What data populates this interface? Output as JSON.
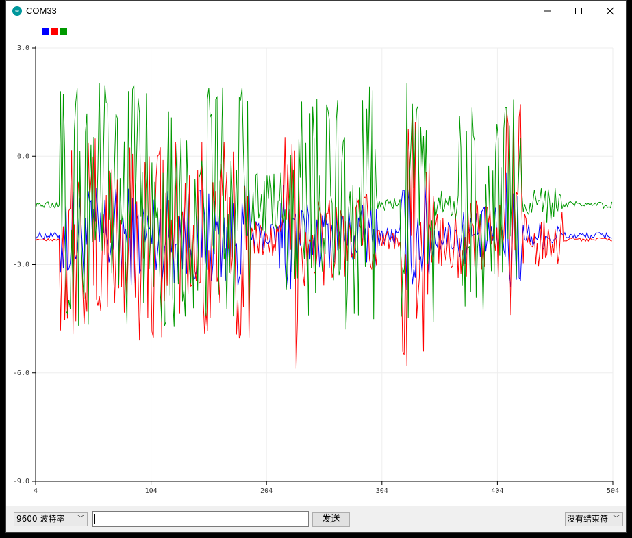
{
  "window": {
    "title": "COM33",
    "app_icon": "arduino-logo-icon"
  },
  "legend": {
    "colors": [
      "#0000ff",
      "#ff0000",
      "#009900"
    ]
  },
  "chart_data": {
    "type": "line",
    "xlim": [
      4,
      504
    ],
    "ylim": [
      -9.0,
      3.0
    ],
    "x_ticks": [
      "4",
      "104",
      "204",
      "304",
      "404",
      "504"
    ],
    "y_ticks": [
      "3.0",
      "0.0",
      "-3.0",
      "-6.0",
      "-9.0"
    ],
    "grid": true,
    "legend_placement": "top-left",
    "series": [
      {
        "color": "#0000ff",
        "baseline": -2.2,
        "segments": [
          {
            "x": [
              4,
              25
            ],
            "amp": 0.1
          },
          {
            "x": [
              25,
              190
            ],
            "amp": 1.4
          },
          {
            "x": [
              190,
              215
            ],
            "amp": 0.4
          },
          {
            "x": [
              215,
              232
            ],
            "amp": 2.0
          },
          {
            "x": [
              232,
              300
            ],
            "amp": 0.9
          },
          {
            "x": [
              300,
              320
            ],
            "amp": 0.3
          },
          {
            "x": [
              320,
              349
            ],
            "amp": 1.6
          },
          {
            "x": [
              349,
              370
            ],
            "amp": 0.5
          },
          {
            "x": [
              370,
              410
            ],
            "amp": 0.8
          },
          {
            "x": [
              410,
              424
            ],
            "amp": 1.8
          },
          {
            "x": [
              424,
              460
            ],
            "amp": 0.4
          },
          {
            "x": [
              460,
              504
            ],
            "amp": 0.1
          }
        ]
      },
      {
        "color": "#ff0000",
        "baseline": -2.3,
        "segments": [
          {
            "x": [
              4,
              25
            ],
            "amp": 0.05
          },
          {
            "x": [
              25,
              190
            ],
            "amp": 2.8
          },
          {
            "x": [
              190,
              218
            ],
            "amp": 0.5
          },
          {
            "x": [
              218,
              232
            ],
            "amp": 3.6
          },
          {
            "x": [
              232,
              300
            ],
            "amp": 1.3
          },
          {
            "x": [
              300,
              320
            ],
            "amp": 0.3
          },
          {
            "x": [
              320,
              349
            ],
            "amp": 3.6
          },
          {
            "x": [
              349,
              410
            ],
            "amp": 1.1
          },
          {
            "x": [
              410,
              424
            ],
            "amp": 3.9
          },
          {
            "x": [
              424,
              460
            ],
            "amp": 0.8
          },
          {
            "x": [
              460,
              504
            ],
            "amp": 0.05
          }
        ]
      },
      {
        "color": "#009900",
        "baseline": -1.35,
        "segments": [
          {
            "x": [
              4,
              25
            ],
            "amp": 0.1
          },
          {
            "x": [
              25,
              190
            ],
            "amp": 3.4
          },
          {
            "x": [
              190,
              215
            ],
            "amp": 0.9
          },
          {
            "x": [
              215,
              232
            ],
            "amp": 2.4
          },
          {
            "x": [
              232,
              300
            ],
            "amp": 3.6
          },
          {
            "x": [
              300,
              320
            ],
            "amp": 0.2
          },
          {
            "x": [
              320,
              349
            ],
            "amp": 3.4
          },
          {
            "x": [
              349,
              370
            ],
            "amp": 0.4
          },
          {
            "x": [
              370,
              424
            ],
            "amp": 3.1
          },
          {
            "x": [
              424,
              460
            ],
            "amp": 0.5
          },
          {
            "x": [
              460,
              504
            ],
            "amp": 0.1
          }
        ]
      }
    ]
  },
  "bottom_bar": {
    "baud_rate": "9600 波特率",
    "send_input_value": "",
    "send_button_label": "发送",
    "line_ending": "没有结束符"
  }
}
